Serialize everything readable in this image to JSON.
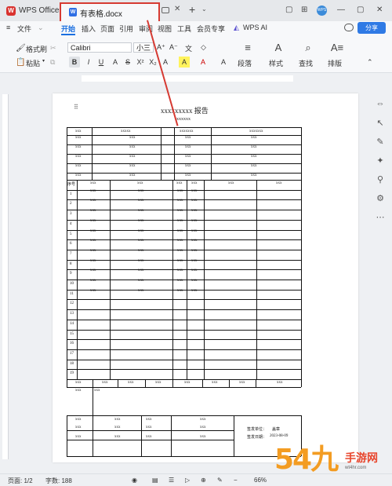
{
  "titlebar": {
    "app_name": "WPS Office",
    "app_logo": "W",
    "tab_icon": "W",
    "tab_title": "有表格.docx",
    "tab_close": "✕",
    "tab_add": "+",
    "tab_more": "⌄",
    "avatar": "WPS",
    "controls": [
      "▢",
      "⊞",
      "—",
      "▢",
      "✕"
    ]
  },
  "menubar": {
    "file": "文件",
    "items": [
      "开始",
      "插入",
      "页面",
      "引用",
      "审阅",
      "视图",
      "工具",
      "会员专享"
    ],
    "wps_ai": "WPS AI",
    "share": "分享"
  },
  "ribbon": {
    "format_painter": "格式刷",
    "paste": "粘贴",
    "font": "Calibri",
    "font_size": "小三",
    "paragraph": "段落",
    "style": "样式",
    "find": "查找",
    "arrange": "排版",
    "fmt_buttons": [
      "B",
      "I",
      "U",
      "A",
      "S",
      "X²",
      "X₂",
      "A",
      "A",
      "A",
      "A"
    ]
  },
  "document": {
    "title": "xxxxxxxxx 报告",
    "subtitle": "xxxxxx",
    "header_row": [
      "xxx",
      "xxxxx",
      "xxxxxxx",
      "xxxxxxx"
    ],
    "info_rows": [
      [
        "xxx",
        "xxx",
        "xxx",
        "xxx"
      ],
      [
        "xxx",
        "xxx",
        "xxx",
        "xxx"
      ],
      [
        "xxx",
        "xxx",
        "xxx",
        "xxx"
      ],
      [
        "xxx",
        "xxx",
        "xxx",
        "xxx"
      ],
      [
        "xxx",
        "xxx",
        "xxx",
        "xxx"
      ]
    ],
    "table_header": [
      "序号",
      "xxx",
      "xxx",
      "xxx",
      "xxx",
      "xxx",
      "xxx"
    ],
    "row_numbers": [
      "1",
      "2",
      "3",
      "4",
      "5",
      "6",
      "7",
      "8",
      "9",
      "10",
      "11",
      "12",
      "13",
      "14",
      "15",
      "16",
      "17",
      "18",
      "19"
    ],
    "row_cell": "xxx",
    "footer_row": [
      "xxx",
      "xxx",
      "xxx",
      "xxx",
      "xxx",
      "xxx",
      "xxx",
      "xxx",
      "xxx"
    ],
    "footer_row2": [
      "xxx",
      "xxx"
    ],
    "sign_rows": [
      [
        "xxx",
        "xxx",
        "xxx",
        "xxx"
      ],
      [
        "xxx",
        "xxx",
        "xxx",
        "xxx"
      ],
      [
        "xxx",
        "xxx",
        "xxx",
        "xxx"
      ]
    ],
    "sign_unit_label": "签发单位：",
    "sign_unit_value": "盖章",
    "sign_date_label": "签发日期：",
    "sign_date_value": "2023-08-09"
  },
  "statusbar": {
    "page": "页面: 1/2",
    "words": "字数: 188",
    "zoom": "66%"
  },
  "watermark": {
    "big": "54九",
    "text": "手游网",
    "url": "wt4hr.com"
  },
  "colors": {
    "accent": "#1a6fe0",
    "highlight_box": "#d63a32",
    "wps_red": "#d9322e"
  }
}
